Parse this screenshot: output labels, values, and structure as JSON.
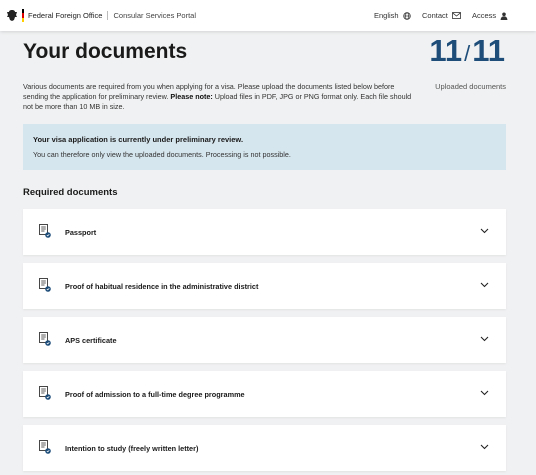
{
  "header": {
    "brand_name": "Federal Foreign Office",
    "brand_sub": "Consular Services Portal",
    "language": "English",
    "contact": "Contact",
    "access": "Access"
  },
  "page": {
    "title": "Your documents",
    "uploaded_count": "11",
    "slash": "/",
    "total_count": "11",
    "uploaded_label": "Uploaded documents",
    "intro_text": "Various documents are required from you when applying for a visa. Please upload the documents listed below before sending the application for preliminary review. ",
    "intro_note_label": "Please note:",
    "intro_note_text": " Upload files in PDF, JPG or PNG format only. Each file should not be more than 10 MB in size."
  },
  "notice": {
    "title": "Your visa application is currently under preliminary review.",
    "body": "You can therefore only view the uploaded documents. Processing is not possible."
  },
  "required": {
    "heading": "Required documents",
    "items": [
      {
        "label": "Passport"
      },
      {
        "label": "Proof of habitual residence in the administrative district"
      },
      {
        "label": "APS certificate"
      },
      {
        "label": "Proof of admission to a full-time degree programme"
      },
      {
        "label": "Intention to study (freely written letter)"
      }
    ]
  },
  "colors": {
    "accent": "#1e4d7a",
    "notice_bg": "#d6e6ee",
    "page_bg": "#f0f1f2"
  },
  "icons": {
    "language": "globe-icon",
    "contact": "mail-icon",
    "access": "person-icon",
    "document": "document-check-icon",
    "expand": "chevron-down-icon"
  }
}
